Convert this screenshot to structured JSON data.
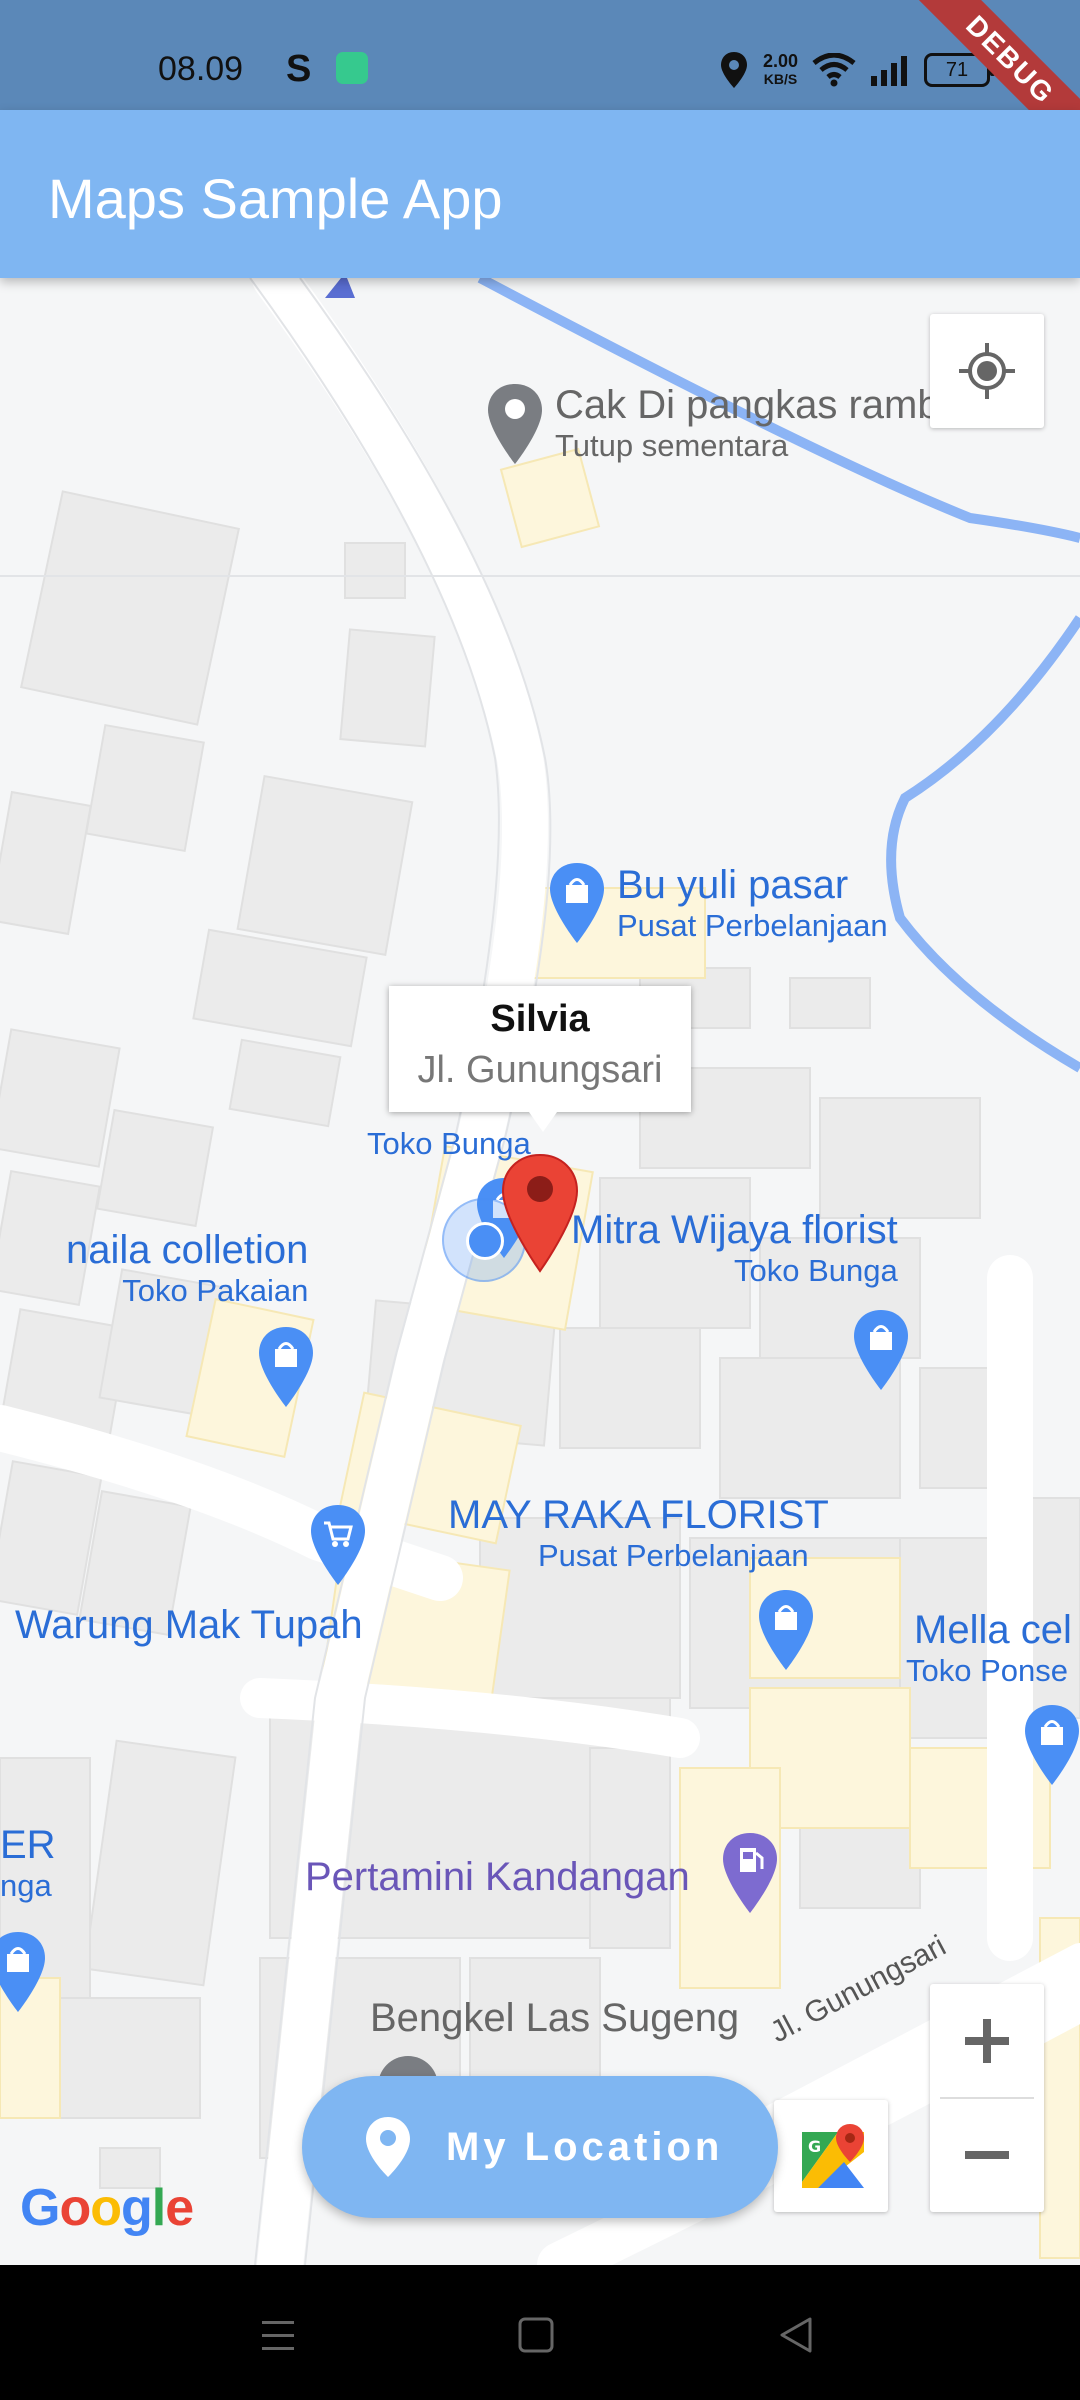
{
  "status_bar": {
    "time": "08.09",
    "s_icon": "S",
    "app_icon": "green-app-icon",
    "speed_value": "2.00",
    "speed_unit": "KB/S",
    "battery": "71",
    "icons": [
      "location-icon",
      "wifi-icon",
      "signal-icon",
      "battery-icon",
      "charging-icon"
    ]
  },
  "debug_banner": "DEBUG",
  "app_bar": {
    "title": "Maps Sample App"
  },
  "map": {
    "pois": [
      {
        "name": "Cak Di pangkas rambut",
        "category": "Tutup sementara",
        "icon": "place-pin-icon"
      },
      {
        "name": "Bu yuli pasar",
        "category": "Pusat Perbelanjaan",
        "icon": "shopping-bag-icon"
      },
      {
        "name": "Toko Bunga",
        "icon": "shopping-bag-icon"
      },
      {
        "name": "Mitra Wijaya florist",
        "category": "Toko Bunga",
        "icon": "shopping-bag-icon"
      },
      {
        "name": "naila colletion",
        "category": "Toko Pakaian",
        "icon": "shopping-bag-icon"
      },
      {
        "name": "MAY RAKA FLORIST",
        "category": "Pusat Perbelanjaan",
        "icon": "shopping-bag-icon"
      },
      {
        "name": "Warung Mak Tupah",
        "icon": "shopping-cart-icon"
      },
      {
        "name": "Mella cel",
        "category": "Toko Ponse",
        "icon": "shopping-bag-icon"
      },
      {
        "name": "Pertamini Kandangan",
        "icon": "gas-station-icon"
      },
      {
        "name": "ER",
        "category": "nga",
        "icon": "shopping-bag-icon"
      },
      {
        "name": "Bengkel Las Sugeng"
      }
    ],
    "street": "Jl. Gunungsari",
    "info_window": {
      "title": "Silvia",
      "snippet": "Jl. Gunungsari"
    },
    "colors": {
      "marker": "#ea4335",
      "poi_text": "#2a6dd6",
      "app_bar": "#7fb6f2",
      "river": "#8cb4f5"
    }
  },
  "controls": {
    "my_location_icon": "crosshair-icon",
    "zoom_in": "+",
    "zoom_out": "−",
    "google_maps_icon": "google-maps-icon",
    "google_logo": "Google"
  },
  "fab": {
    "icon": "location-pin-icon",
    "label": "My Location"
  },
  "nav_bar": [
    "menu-icon",
    "home-icon",
    "back-icon"
  ]
}
